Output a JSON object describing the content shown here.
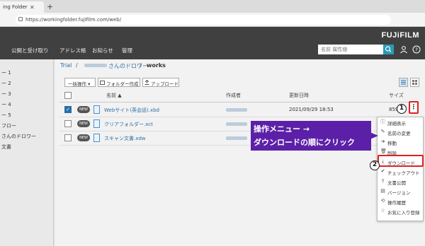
{
  "browser": {
    "tab_title": "ing Folder",
    "tab_close": "✕",
    "new_tab": "+",
    "url": "https://workingfolder.fujifilm.com/web/"
  },
  "header": {
    "logo": "FUJiFILM",
    "nav": [
      "公開と受け取り",
      "アドレス帳",
      "お知らせ",
      "管理"
    ],
    "search_placeholder": "名前 属性値"
  },
  "sidebar": {
    "items": [
      "ー 1",
      "ー 2",
      "ー 3",
      "ー 4",
      "ー 5",
      "フロー",
      "さんのドロワー",
      "文書"
    ]
  },
  "breadcrumb": {
    "root": "Trial",
    "middle": "さんのドロワー",
    "current": "works",
    "sep": "/"
  },
  "toolbar": {
    "bulk": "一括操作 ▾",
    "new_folder": "フォルダー作成",
    "upload": "アップロード"
  },
  "table": {
    "columns": {
      "name": "名前 ▲",
      "creator": "作成者",
      "updated": "更新日時",
      "size": "サイズ"
    },
    "rows": [
      {
        "checked": true,
        "badge": "NEW",
        "name": "Webサイト(英会話).xbd",
        "date": "2021/09/29 18:53",
        "size": "859.2"
      },
      {
        "checked": false,
        "badge": "NEW",
        "name": "クリアフォルダー.xct",
        "date": "",
        "size": ""
      },
      {
        "checked": false,
        "badge": "NEW",
        "name": "スキャン文書.xdw",
        "date": "",
        "size": ""
      }
    ]
  },
  "context_menu": {
    "items": [
      {
        "icon": "ⓘ",
        "label": "詳細表示"
      },
      {
        "icon": "✎",
        "label": "名前の変更"
      },
      {
        "icon": "➜",
        "label": "移動"
      },
      {
        "icon": "🗑",
        "label": "削除"
      },
      {
        "icon": "⤓",
        "label": "ダウンロード"
      },
      {
        "icon": "✔",
        "label": "チェックアウト"
      },
      {
        "icon": "⇪",
        "label": "文書公開"
      },
      {
        "icon": "▤",
        "label": "バージョン"
      },
      {
        "icon": "⟲",
        "label": "操作履歴"
      },
      {
        "icon": "☆",
        "label": "お気に入り登録"
      }
    ]
  },
  "annotation": {
    "step1": "1",
    "step2": "2",
    "line1": "操作メニュー →",
    "line2": "ダウンロードの順にクリック",
    "kebab": "⋮"
  },
  "colors": {
    "header": "#404040",
    "accent": "#2a9bb6",
    "highlight": "#e02020",
    "callout": "#5c20a8"
  }
}
